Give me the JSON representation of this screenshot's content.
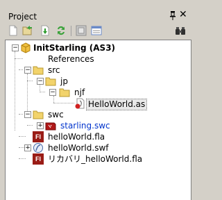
{
  "panel": {
    "title": "Project",
    "pin_icon": "pin-icon",
    "close_icon": "close-icon"
  },
  "toolbar": {
    "buttons": [
      "new-file-icon",
      "open-icon",
      "save-icon",
      "refresh-icon",
      "build-icon",
      "properties-icon",
      "binoculars-icon"
    ]
  },
  "tree": {
    "project": "InitStarling (AS3)",
    "references": "References",
    "src": "src",
    "jp": "jp",
    "njf": "njf",
    "hello_as": "HelloWorld.as",
    "swc": "swc",
    "starling_swc": "starling.swc",
    "hello_fla": "helloWorld.fla",
    "hello_swf": "helloWorld.swf",
    "recovery_fla": "リカバリ_helloWorld.fla",
    "fl_badge": "Fl",
    "expand_minus": "−",
    "expand_plus": "+"
  },
  "colors": {
    "panel_bg": "#d4d0c8",
    "tree_bg": "#ffffff",
    "folder": "#f2d36b",
    "fla_badge": "#9a1c16",
    "link_text": "#0033cc"
  }
}
